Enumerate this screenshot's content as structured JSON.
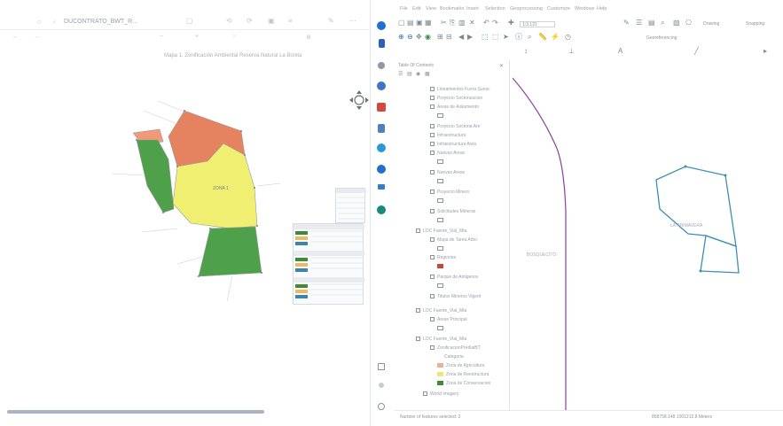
{
  "left_window": {
    "title_text": "",
    "file_tab": "DUCONTRATO_BWT_R...",
    "map_title": "Mapa 1. Zonificación Ambiental Reserva Natural La Bonita",
    "zone_label": "ZONA 1"
  },
  "right_window": {
    "menu": [
      "File",
      "Edit",
      "View",
      "Bookmarks",
      "Insert",
      "Selection",
      "Geoprocessing",
      "Customize",
      "Windows",
      "Help"
    ],
    "toolbar_drawing": "Drawing",
    "toolbar_snapping": "Snapping",
    "toolbar_georef": "Georeferencing",
    "scale_value": "1:3,131",
    "toc": {
      "title": "Table Of Contents",
      "items": [
        "Lineamientos Fuera Sunsc",
        "Proyecto Sectorizacion",
        "Areas de Aislamiento",
        "Proyecto Sectoria Are",
        "Infraestructura",
        "Infraestructura Area",
        "Nuevas Areas",
        "Nuevas Areas",
        "Proyecto Minero",
        "Solicitudes Mineras",
        "LOC Fuente_Vial_Mta",
        "Mapa de Tarea Arbo",
        "Regiones",
        "Parque de Antigenos",
        "Titulos Mineros Vigent",
        "LOC Fuente_Vial_Mta",
        "Areas Principal",
        "LOC Fuente_Vial_Mta",
        "ZonificacionPredialBT",
        "Categoria",
        "Zona de Agricultura",
        "Zona de Reestructura",
        "Zona de Conservacion",
        "World Imagery"
      ]
    },
    "canvas_label": "BOSQUECITO",
    "polygon_label": "LA PRIMAVERA",
    "status_left": "Number of features selected: 2",
    "status_right": "858758.148  1001212.8 Meters"
  },
  "colors": {
    "zone_red": "#e5825f",
    "zone_yellow": "#f1ef72",
    "zone_green": "#4fa04a",
    "polygon_blue": "#3d8fb3",
    "river_purple": "#8a3f9a",
    "swatch_red": "#c9463d",
    "swatch_tan": "#e5b497",
    "swatch_yellow": "#f0e27d",
    "swatch_green": "#3e8a3a"
  }
}
